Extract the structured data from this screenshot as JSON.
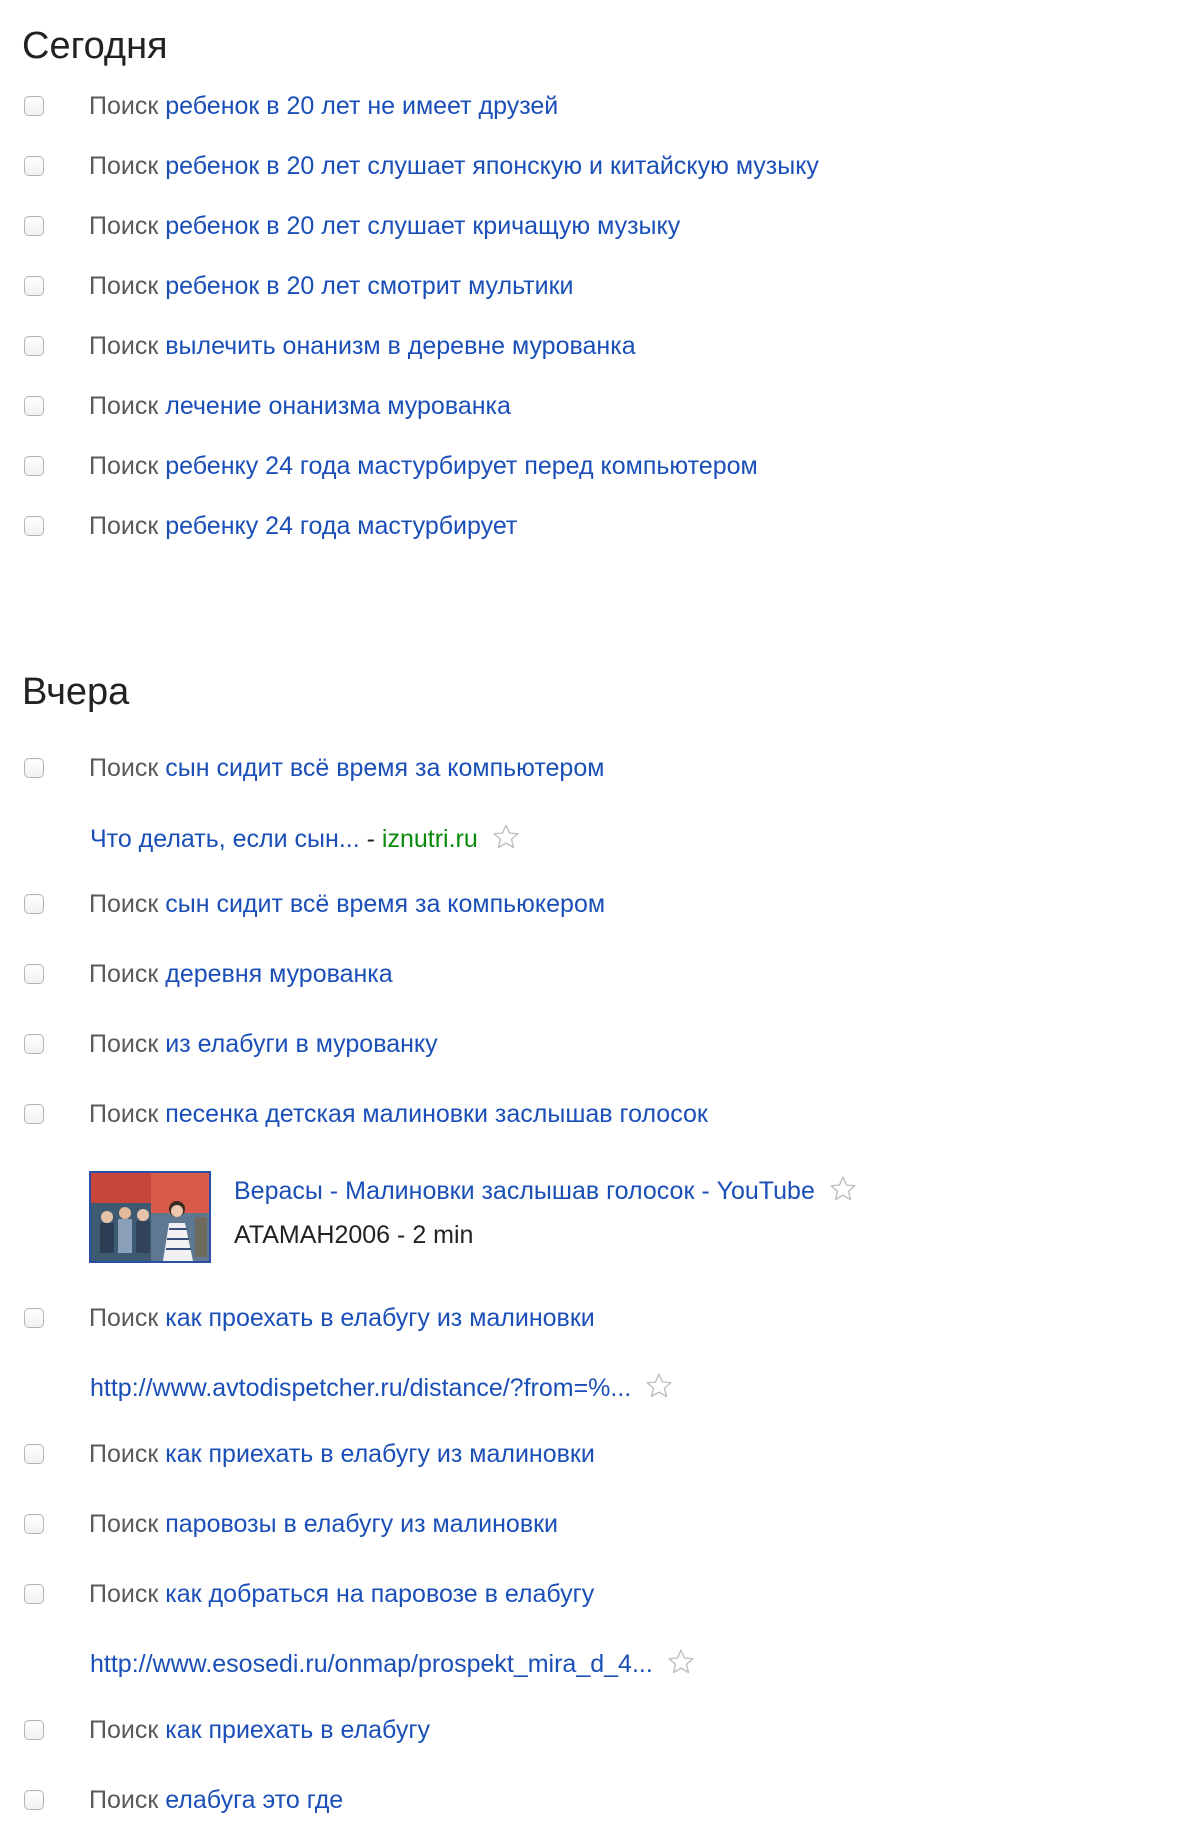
{
  "sections": [
    {
      "title": "Сегодня",
      "entries": [
        {
          "prefix": "Поиск",
          "query": "ребенок в 20 лет не имеет друзей"
        },
        {
          "prefix": "Поиск",
          "query": "ребенок в 20 лет слушает японскую и китайскую музыку"
        },
        {
          "prefix": "Поиск",
          "query": "ребенок в 20 лет слушает кричащую музыку"
        },
        {
          "prefix": "Поиск",
          "query": "ребенок в 20 лет смотрит мультики"
        },
        {
          "prefix": "Поиск",
          "query": "вылечить онанизм в деревне мурованка"
        },
        {
          "prefix": "Поиск",
          "query": "лечение онанизма мурованка"
        },
        {
          "prefix": "Поиск",
          "query": "ребенку 24 года мастурбирует перед компьютером"
        },
        {
          "prefix": "Поиск",
          "query": "ребенку 24 года мастурбирует"
        }
      ]
    },
    {
      "title": "Вчера",
      "entries": [
        {
          "prefix": "Поиск",
          "query": "сын сидит всё время за компьютером"
        },
        {
          "prefix": "Поиск",
          "query": "сын сидит всё время за компьюкером"
        },
        {
          "prefix": "Поиск",
          "query": "деревня мурованка"
        },
        {
          "prefix": "Поиск",
          "query": "из елабуги в мурованку"
        },
        {
          "prefix": "Поиск",
          "query": "песенка детская малиновки заслышав голосок"
        },
        {
          "prefix": "Поиск",
          "query": "как проехать в елабугу из малиновки"
        },
        {
          "prefix": "Поиск",
          "query": "как приехать в елабугу из малиновки"
        },
        {
          "prefix": "Поиск",
          "query": "паровозы в елабугу из малиновки"
        },
        {
          "prefix": "Поиск",
          "query": "как добраться на паровозе в елабугу"
        },
        {
          "prefix": "Поиск",
          "query": "как приехать в елабугу"
        },
        {
          "prefix": "Поиск",
          "query": "елабуга это где"
        }
      ]
    }
  ],
  "results": {
    "iznutri": {
      "title": "Что делать, если сын...",
      "separator": "-",
      "domain": "iznutri.ru"
    },
    "avtodispatcher": {
      "url": "http://www.avtodispetcher.ru/distance/?from=%..."
    },
    "esosedi": {
      "url": "http://www.esosedi.ru/onmap/prospekt_mira_d_4..."
    }
  },
  "video": {
    "title": "Верасы - Малиновки заслышав голосок - YouTube",
    "channel": "ATAMAH2006",
    "separator": "-",
    "duration": "2 min"
  },
  "colors": {
    "link": "#1a4fb8",
    "domain": "#0a8a0a",
    "prefix": "#5a5a5a",
    "heading": "#222222"
  },
  "icons": {
    "star": "star-outline-icon",
    "checkbox": "checkbox-unchecked"
  }
}
